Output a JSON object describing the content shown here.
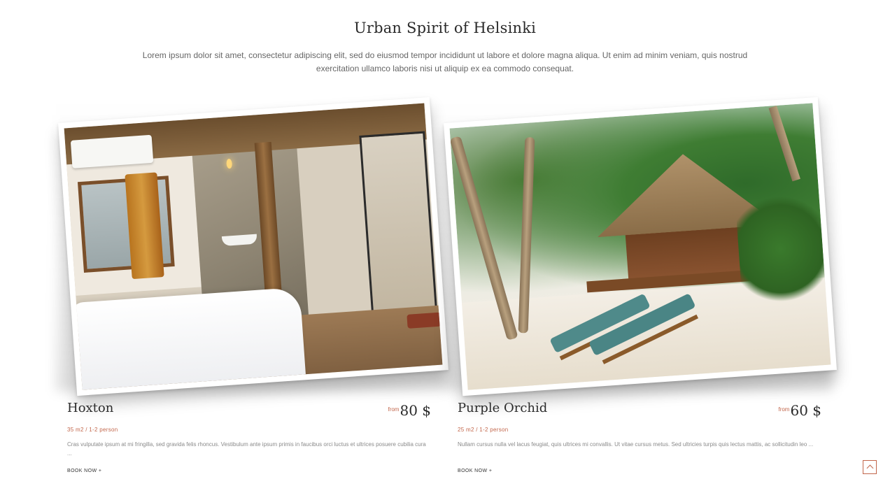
{
  "section": {
    "title": "Urban Spirit of Helsinki",
    "description": "Lorem ipsum dolor sit amet, consectetur adipiscing elit, sed do eiusmod tempor incididunt ut labore et dolore magna aliqua. Ut enim ad minim veniam, quis nostrud exercitation ullamco laboris nisi ut aliquip ex ea commodo consequat."
  },
  "rooms": [
    {
      "name": "Hoxton",
      "price_prefix": "from",
      "price": "80 $",
      "meta": "35 m2 / 1-2 person",
      "description": "Cras vulputate ipsum at mi fringilla, sed gravida felis rhoncus. Vestibulum ante ipsum primis in faucibus orci luctus et ultrices posuere cubilia cura ...",
      "cta": "BOOK NOW +"
    },
    {
      "name": "Purple Orchid",
      "price_prefix": "from",
      "price": "60 $",
      "meta": "25 m2 / 1-2 person",
      "description": "Nullam cursus nulla vel lacus feugiat, quis ultrices mi convallis. Ut vitae cursus metus. Sed ultricies turpis quis lectus mattis, ac sollicitudin leo ...",
      "cta": "BOOK NOW +"
    }
  ],
  "colors": {
    "accent": "#c2664b",
    "text": "#2b2b2b",
    "muted": "#8a8a8a"
  },
  "icons": {
    "scroll_top": "chevron-up-icon"
  }
}
